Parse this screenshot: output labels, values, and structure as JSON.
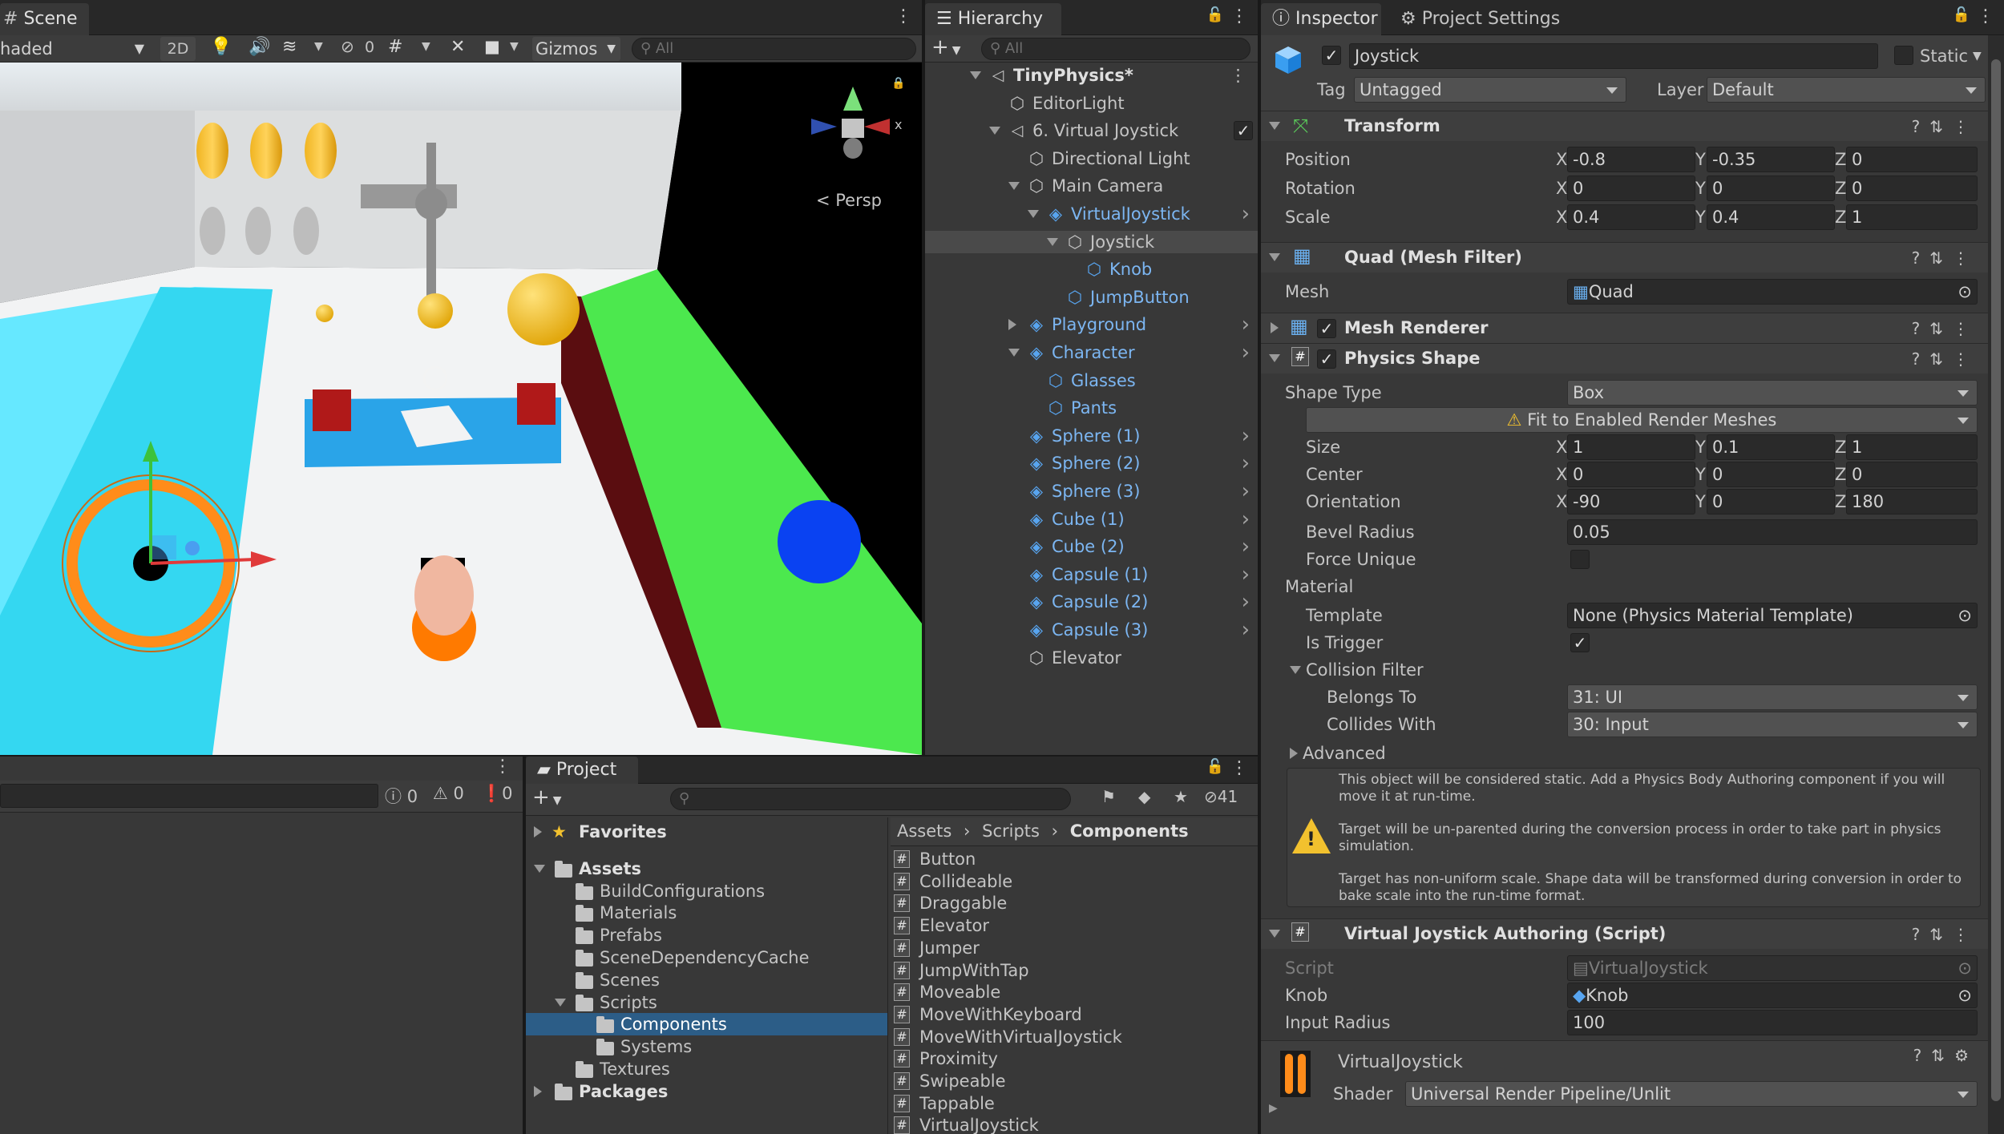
{
  "scene": {
    "tab": "Scene",
    "shading": "haded",
    "mode_2d": "2D",
    "hidden_count": "0",
    "gizmos": "Gizmos",
    "search_placeholder": "All",
    "persp": "< Persp"
  },
  "hierarchy": {
    "tab": "Hierarchy",
    "search_placeholder": "All",
    "items": [
      {
        "label": "TinyPhysics*",
        "indent": 0,
        "bold": true,
        "expand": "down",
        "icon": "unity-logo-icon"
      },
      {
        "label": "EditorLight",
        "indent": 1,
        "icon": "cube-icon"
      },
      {
        "label": "6. Virtual Joystick",
        "indent": 1,
        "expand": "down",
        "icon": "unity-logo-icon",
        "selected_scene": true
      },
      {
        "label": "Directional Light",
        "indent": 2,
        "icon": "cube-icon"
      },
      {
        "label": "Main Camera",
        "indent": 2,
        "expand": "down",
        "icon": "cube-icon"
      },
      {
        "label": "VirtualJoystick",
        "indent": 3,
        "expand": "down",
        "icon": "prefab-icon",
        "prefab": true,
        "arrow": true
      },
      {
        "label": "Joystick",
        "indent": 4,
        "expand": "down",
        "icon": "cube-icon",
        "selected": true
      },
      {
        "label": "Knob",
        "indent": 5,
        "icon": "cube-icon",
        "prefab": true
      },
      {
        "label": "JumpButton",
        "indent": 4,
        "icon": "cube-icon",
        "prefab": true
      },
      {
        "label": "Playground",
        "indent": 2,
        "expand": "right",
        "icon": "prefab-icon",
        "prefab": true,
        "arrow": true
      },
      {
        "label": "Character",
        "indent": 2,
        "expand": "down",
        "icon": "prefab-icon",
        "prefab": true,
        "arrow": true
      },
      {
        "label": "Glasses",
        "indent": 3,
        "icon": "cube-icon",
        "prefab": true
      },
      {
        "label": "Pants",
        "indent": 3,
        "icon": "cube-icon",
        "prefab": true
      },
      {
        "label": "Sphere (1)",
        "indent": 2,
        "icon": "prefab-icon",
        "prefab": true,
        "arrow": true
      },
      {
        "label": "Sphere (2)",
        "indent": 2,
        "icon": "prefab-icon",
        "prefab": true,
        "arrow": true
      },
      {
        "label": "Sphere (3)",
        "indent": 2,
        "icon": "prefab-icon",
        "prefab": true,
        "arrow": true
      },
      {
        "label": "Cube (1)",
        "indent": 2,
        "icon": "prefab-icon",
        "prefab": true,
        "arrow": true
      },
      {
        "label": "Cube (2)",
        "indent": 2,
        "icon": "prefab-icon",
        "prefab": true,
        "arrow": true
      },
      {
        "label": "Capsule (1)",
        "indent": 2,
        "icon": "prefab-icon",
        "prefab": true,
        "arrow": true
      },
      {
        "label": "Capsule (2)",
        "indent": 2,
        "icon": "prefab-icon",
        "prefab": true,
        "arrow": true
      },
      {
        "label": "Capsule (3)",
        "indent": 2,
        "icon": "prefab-icon",
        "prefab": true,
        "arrow": true
      },
      {
        "label": "Elevator",
        "indent": 2,
        "icon": "cube-icon"
      }
    ]
  },
  "console": {
    "count_info": "0",
    "count_warn": "0",
    "count_error": "0"
  },
  "project": {
    "tab": "Project",
    "hidden_count": "41",
    "tree": [
      {
        "label": "Favorites",
        "indent": 0,
        "bold": true,
        "expand": "right",
        "icon": "star-icon"
      },
      {
        "label": "Assets",
        "indent": 0,
        "bold": true,
        "expand": "down",
        "icon": "folder-icon",
        "gap": true
      },
      {
        "label": "BuildConfigurations",
        "indent": 1,
        "icon": "folder-icon"
      },
      {
        "label": "Materials",
        "indent": 1,
        "icon": "folder-icon"
      },
      {
        "label": "Prefabs",
        "indent": 1,
        "icon": "folder-icon"
      },
      {
        "label": "SceneDependencyCache",
        "indent": 1,
        "icon": "folder-icon"
      },
      {
        "label": "Scenes",
        "indent": 1,
        "icon": "folder-icon"
      },
      {
        "label": "Scripts",
        "indent": 1,
        "expand": "down",
        "icon": "folder-icon"
      },
      {
        "label": "Components",
        "indent": 2,
        "icon": "folder-icon",
        "selected": true
      },
      {
        "label": "Systems",
        "indent": 2,
        "icon": "folder-icon"
      },
      {
        "label": "Textures",
        "indent": 1,
        "icon": "folder-icon"
      },
      {
        "label": "Packages",
        "indent": 0,
        "bold": true,
        "expand": "right",
        "icon": "folder-icon"
      }
    ],
    "breadcrumb": [
      "Assets",
      "Scripts",
      "Components"
    ],
    "files": [
      "Button",
      "Collideable",
      "Draggable",
      "Elevator",
      "Jumper",
      "JumpWithTap",
      "Moveable",
      "MoveWithKeyboard",
      "MoveWithVirtualJoystick",
      "Proximity",
      "Swipeable",
      "Tappable",
      "VirtualJoystick"
    ]
  },
  "inspector": {
    "tab": "Inspector",
    "tab2": "Project Settings",
    "object_name": "Joystick",
    "static_label": "Static",
    "tag_label": "Tag",
    "tag_value": "Untagged",
    "layer_label": "Layer",
    "layer_value": "Default",
    "transform": {
      "title": "Transform",
      "position_label": "Position",
      "pos": [
        "-0.8",
        "-0.35",
        "0"
      ],
      "rotation_label": "Rotation",
      "rot": [
        "0",
        "0",
        "0"
      ],
      "scale_label": "Scale",
      "scale": [
        "0.4",
        "0.4",
        "1"
      ]
    },
    "axes": [
      "X",
      "Y",
      "Z"
    ],
    "mesh_filter": {
      "title": "Quad (Mesh Filter)",
      "mesh_label": "Mesh",
      "mesh_value": "Quad"
    },
    "mesh_renderer": {
      "title": "Mesh Renderer"
    },
    "physics_shape": {
      "title": "Physics Shape",
      "shape_type_label": "Shape Type",
      "shape_type": "Box",
      "fit_button": "Fit to Enabled Render Meshes",
      "size_label": "Size",
      "size": [
        "1",
        "0.1",
        "1"
      ],
      "center_label": "Center",
      "center": [
        "0",
        "0",
        "0"
      ],
      "orientation_label": "Orientation",
      "orientation": [
        "-90",
        "0",
        "180"
      ],
      "bevel_label": "Bevel Radius",
      "bevel": "0.05",
      "force_unique_label": "Force Unique",
      "material_label": "Material",
      "template_label": "Template",
      "template": "None (Physics Material Template)",
      "is_trigger_label": "Is Trigger",
      "collision_filter_label": "Collision Filter",
      "belongs_to_label": "Belongs To",
      "belongs_to": "31: UI",
      "collides_with_label": "Collides With",
      "collides_with": "30: Input",
      "advanced_label": "Advanced",
      "warning1": "This object will be considered static. Add a Physics Body Authoring component if you will move it at run-time.",
      "warning2": "Target will be un-parented during the conversion process in order to take part in physics simulation.",
      "warning3": "Target has non-uniform scale. Shape data will be transformed during conversion in order to bake scale into the run-time format."
    },
    "vj": {
      "title": "Virtual Joystick Authoring (Script)",
      "script_label": "Script",
      "script_value": "VirtualJoystick",
      "knob_label": "Knob",
      "knob_value": "Knob",
      "radius_label": "Input Radius",
      "radius_value": "100"
    },
    "material": {
      "name": "VirtualJoystick",
      "shader_label": "Shader",
      "shader_value": "Universal Render Pipeline/Unlit"
    }
  }
}
